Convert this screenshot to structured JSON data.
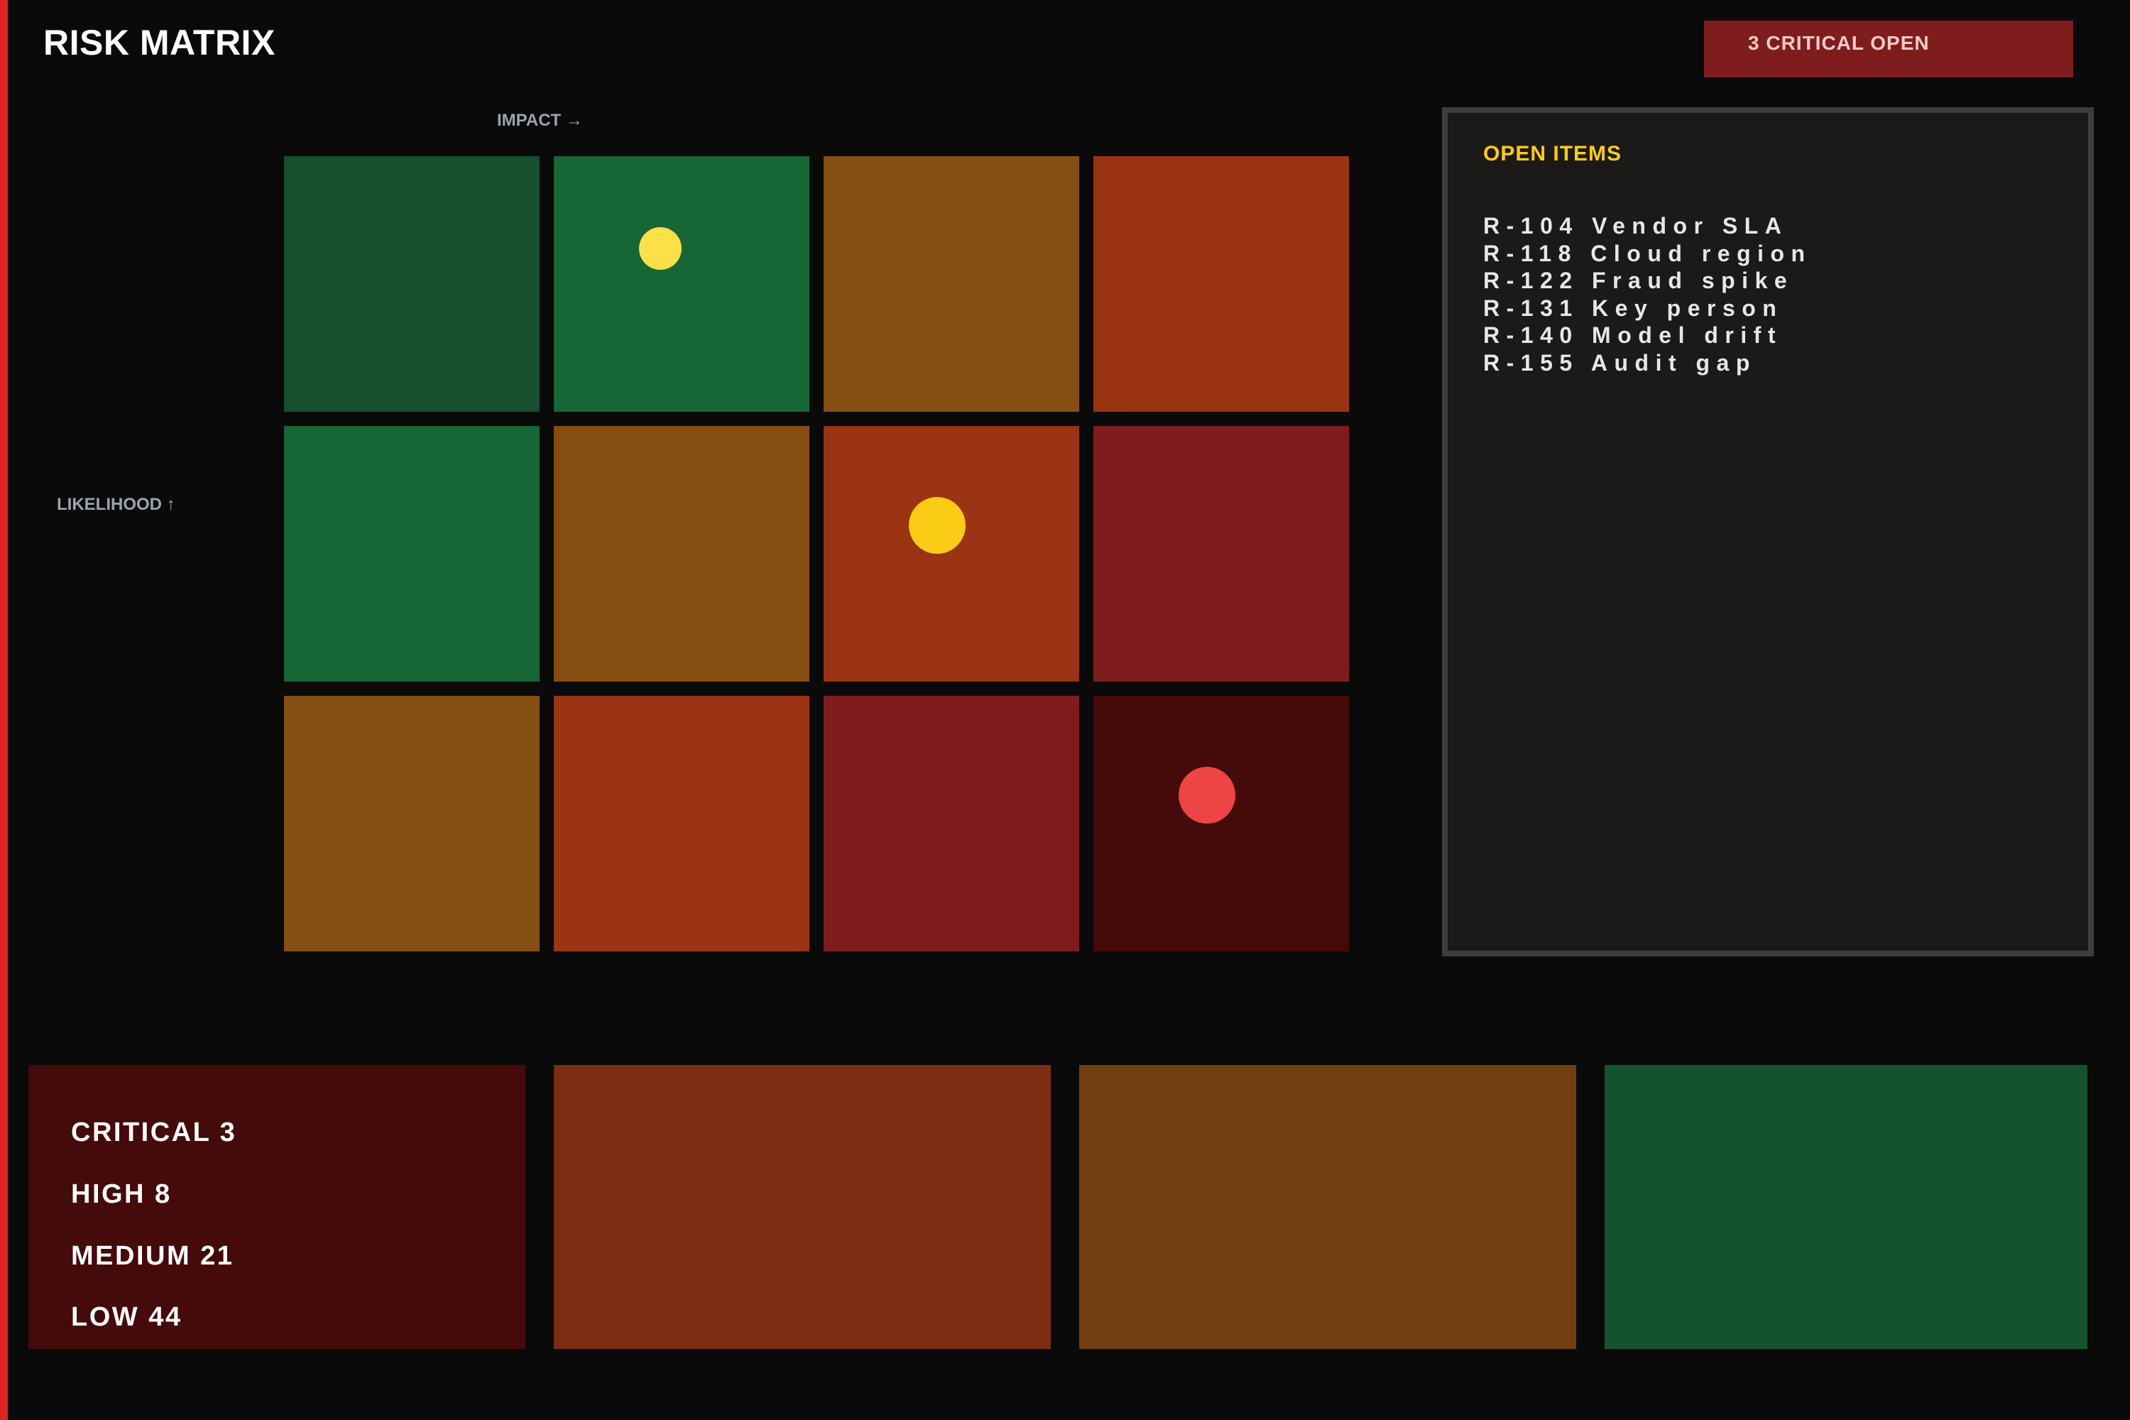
{
  "header": {
    "title": "RISK MATRIX",
    "critical_badge": "3 CRITICAL OPEN"
  },
  "matrix": {
    "impact_label": "IMPACT →",
    "likelihood_label": "LIKELIHOOD ↑",
    "colors": {
      "low": "#16502e",
      "low_mid": "#176636",
      "medium": "#854f11",
      "high": "#9a3412",
      "very_high": "#7f1d1d",
      "critical": "#450a0a"
    },
    "markers": [
      {
        "row": 1,
        "col": 2,
        "color": "#fde047"
      },
      {
        "row": 2,
        "col": 3,
        "color": "#facc15"
      },
      {
        "row": 3,
        "col": 4,
        "color": "#ef4444"
      }
    ]
  },
  "open_items": {
    "title": "OPEN ITEMS",
    "items": [
      "R-104 Vendor SLA",
      "R-118 Cloud region",
      "R-122 Fraud spike",
      "R-131 Key person",
      "R-140 Model drift",
      "R-155 Audit gap"
    ]
  },
  "summary": {
    "critical": "CRITICAL 3",
    "high": "HIGH 8",
    "medium": "MEDIUM 21",
    "low": "LOW 44",
    "card_colors": [
      "#450a0a",
      "#7c2d12",
      "#713f12",
      "#14532d"
    ]
  }
}
